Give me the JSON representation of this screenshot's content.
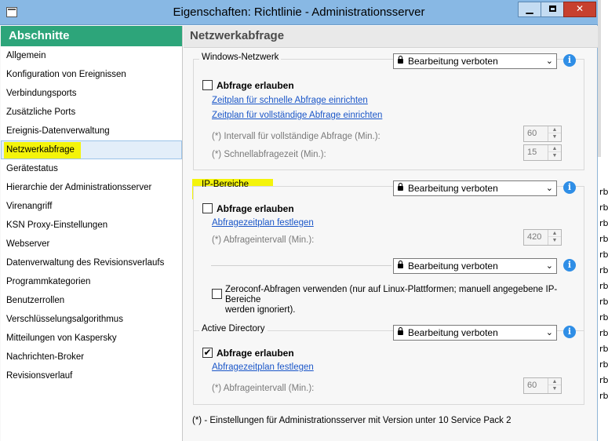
{
  "window": {
    "title": "Eigenschaften: Richtlinie - Administrationsserver",
    "minimize_label": "▁",
    "close_label": "✕"
  },
  "sidebar": {
    "header": "Abschnitte",
    "items": [
      {
        "label": "Allgemein"
      },
      {
        "label": "Konfiguration von Ereignissen"
      },
      {
        "label": "Verbindungsports"
      },
      {
        "label": "Zusätzliche Ports"
      },
      {
        "label": "Ereignis-Datenverwaltung"
      },
      {
        "label": "Netzwerkabfrage",
        "selected": true
      },
      {
        "label": "Gerätestatus"
      },
      {
        "label": "Hierarchie der Administrationsserver"
      },
      {
        "label": "Virenangriff"
      },
      {
        "label": "KSN Proxy-Einstellungen"
      },
      {
        "label": "Webserver"
      },
      {
        "label": "Datenverwaltung des Revisionsverlaufs"
      },
      {
        "label": "Programmkategorien"
      },
      {
        "label": "Benutzerrollen"
      },
      {
        "label": "Verschlüsselungsalgorithmus"
      },
      {
        "label": "Mitteilungen von Kaspersky"
      },
      {
        "label": "Nachrichten-Broker"
      },
      {
        "label": "Revisionsverlauf"
      }
    ]
  },
  "main": {
    "header": "Netzwerkabfrage",
    "lock_text": "Bearbeitung verboten",
    "windows_network": {
      "title": "Windows-Netzwerk",
      "checkbox_label": "Abfrage erlauben",
      "checked": false,
      "link_fast": "Zeitplan für schnelle Abfrage einrichten",
      "link_full": "Zeitplan für vollständige Abfrage einrichten",
      "interval_full_label": "(*) Intervall für vollständige Abfrage (Min.):",
      "interval_full_value": "60",
      "fast_time_label": "(*) Schnellabfragezeit (Min.):",
      "fast_time_value": "15"
    },
    "ip_ranges": {
      "title": "IP-Bereiche",
      "checkbox_label": "Abfrage erlauben",
      "checked": false,
      "link_schedule": "Abfragezeitplan festlegen",
      "interval_label": "(*) Abfrageintervall (Min.):",
      "interval_value": "420",
      "zeroconf_line1": "Zeroconf-Abfragen verwenden (nur auf Linux-Plattformen; manuell angegebene IP-Bereiche",
      "zeroconf_line2": "werden ignoriert)."
    },
    "active_directory": {
      "title": "Active Directory",
      "checkbox_label": "Abfrage erlauben",
      "checked": true,
      "link_schedule": "Abfragezeitplan festlegen",
      "interval_label": "(*) Abfrageintervall (Min.):",
      "interval_value": "60"
    },
    "footnote": "(*) - Einstellungen für Administrationsserver mit Version unter 10 Service Pack 2"
  },
  "backdrop": {
    "fragments": [
      "rb",
      "rb",
      "rb",
      "rb",
      "rb",
      "rb",
      "rb",
      "rb",
      "rb",
      "rb",
      "rb",
      "rb",
      "rb",
      "rb"
    ]
  },
  "colors": {
    "titlebar": "#88b8e4",
    "sidebar_header": "#2da57a",
    "highlight": "#f4f40a",
    "link": "#1a56c8",
    "info": "#2f8ee6",
    "close_button": "#c7402e"
  }
}
